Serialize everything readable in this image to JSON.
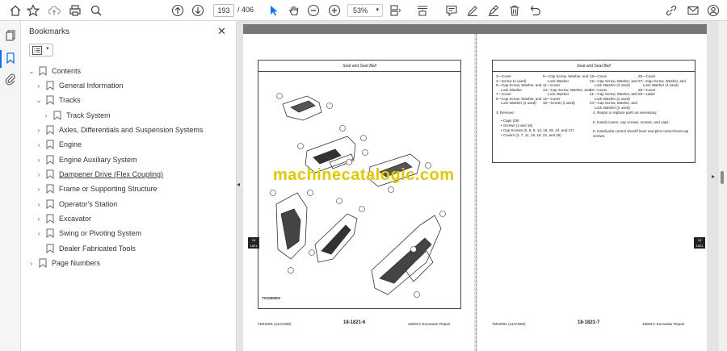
{
  "toolbar": {
    "current_page": "193",
    "total_pages": "/ 406",
    "zoom": "53%"
  },
  "bookmarks_panel": {
    "title": "Bookmarks",
    "items": [
      {
        "label": "Contents",
        "indent": 0,
        "twisty": "open"
      },
      {
        "label": "General Information",
        "indent": 1,
        "twisty": "closed"
      },
      {
        "label": "Tracks",
        "indent": 1,
        "twisty": "open"
      },
      {
        "label": "Track System",
        "indent": 2,
        "twisty": "closed"
      },
      {
        "label": "Axles, Differentials and Suspension Systems",
        "indent": 1,
        "twisty": "closed"
      },
      {
        "label": "Engine",
        "indent": 1,
        "twisty": "closed"
      },
      {
        "label": "Engine Auxiliary System",
        "indent": 1,
        "twisty": "closed"
      },
      {
        "label": "Dampener Drive (Flex Coupling)",
        "indent": 1,
        "twisty": "closed",
        "underline": true
      },
      {
        "label": "Frame or Supporting Structure",
        "indent": 1,
        "twisty": "closed"
      },
      {
        "label": "Operator's Station",
        "indent": 1,
        "twisty": "closed"
      },
      {
        "label": "Excavator",
        "indent": 1,
        "twisty": "closed"
      },
      {
        "label": "Swing or Pivoting System",
        "indent": 1,
        "twisty": "closed"
      },
      {
        "label": "Dealer Fabricated Tools",
        "indent": 1,
        "twisty": "none"
      },
      {
        "label": "Page Numbers",
        "indent": 0,
        "twisty": "closed"
      }
    ]
  },
  "document": {
    "left_page": {
      "header": "Seat and Seat Belt",
      "figure_id": "TX1000001",
      "footer_left": "TM10091 (11JAN08)",
      "footer_center": "18-1821-6",
      "footer_right": "160DLC Excavator Repair"
    },
    "right_page": {
      "header": "Seat and Seat Belt",
      "parts_col1": [
        "3—Cover",
        "4—Screw (4 used)",
        "5—Cap Screw, Washer, and",
        "Lock Washer",
        "7—Cover",
        "8—Cap Screw, Washer, and",
        "Lock Washer (2 used)"
      ],
      "parts_col2": [
        "9—Cap Screw, Washer, and",
        "Lock Washer",
        "11—Cover",
        "13—Cap Screw, Washer, and",
        "Lock Washer",
        "15—Cover",
        "16—Screw (4 used)"
      ],
      "parts_col3": [
        "18—Cover",
        "19—Cap Screw, Washer, and",
        "Lock Washer (2 used)",
        "20—Cover",
        "21—Cap Screw, Washer, and",
        "Lock Washer (2 used)",
        "24—Cap Screw, Washer, and",
        "Lock Washer (2 used)"
      ],
      "parts_col4": [
        "26—Cover",
        "27—Cap Screw, Washer, and",
        "Lock Washer (4 used)",
        "28—Cover",
        "29—Label"
      ],
      "step3": "3.  Remove:",
      "step3_items": [
        "Caps (29)",
        "Screws (4 and 16)",
        "Cap Screws (5, 8, 9, 13, 19, 20, 24, and 27)",
        "Covers (3, 7, 11, 15, 18, 22, and 26)"
      ],
      "step4": "4.  Repair or replace parts as necessary.",
      "step5": "5.  Install covers, cap screws, screws, and caps.",
      "step6": "6.  Install pilot control shutoff lever and pilot control boot cap screws.",
      "footer_left": "TM10091 (11JAN08)",
      "footer_center": "18-1821-7",
      "footer_right": "160DLC Excavator Repair"
    },
    "watermark": "machinecatalogic.com"
  }
}
